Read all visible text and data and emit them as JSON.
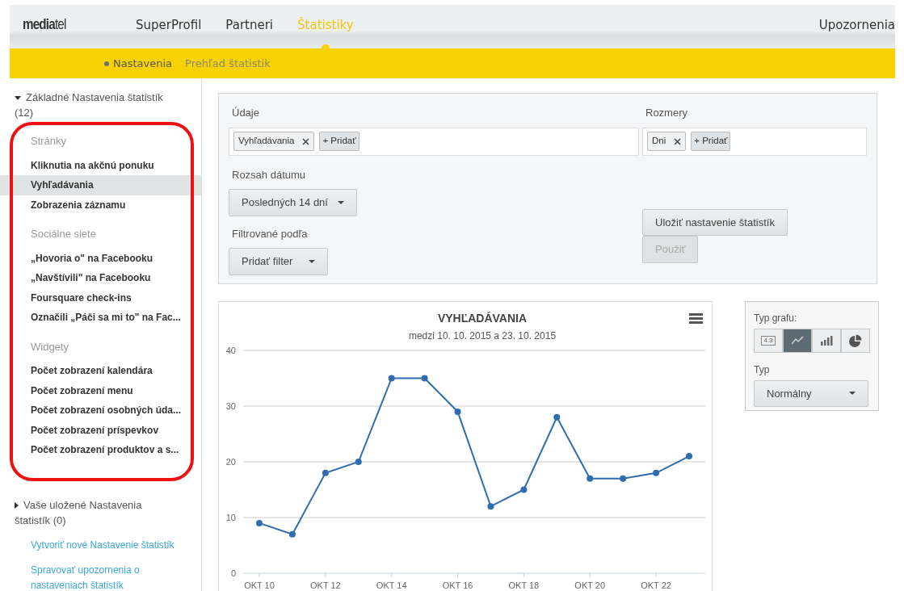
{
  "header": {
    "logo": {
      "main": "media",
      "accent": "tel"
    },
    "nav": [
      {
        "label": "SuperProfil",
        "selected": false
      },
      {
        "label": "Partneri",
        "selected": false
      },
      {
        "label": "Štatistiky",
        "selected": true
      }
    ],
    "right_link": "Upozornenia",
    "subnav": [
      {
        "label": "Nastavenia",
        "selected": true
      },
      {
        "label": "Prehľad štatistik",
        "selected": false
      }
    ]
  },
  "sidebar": {
    "sections": [
      {
        "label": "Základné Nastavenia štatistík (12)",
        "expanded": true,
        "groups": [
          {
            "heading": "Stránky",
            "items": [
              {
                "label": "Kliknutia na akčnú ponuku",
                "selected": false
              },
              {
                "label": "Vyhľadávania",
                "selected": true
              },
              {
                "label": "Zobrazenia záznamu",
                "selected": false
              }
            ]
          },
          {
            "heading": "Sociálne siete",
            "items": [
              {
                "label": "„Hovoria o\" na Facebooku",
                "selected": false
              },
              {
                "label": "„Navštívili\" na Facebooku",
                "selected": false
              },
              {
                "label": "Foursquare check-ins",
                "selected": false
              },
              {
                "label": "Označili „Páči sa mi to\" na Fac...",
                "selected": false
              }
            ]
          },
          {
            "heading": "Widgety",
            "items": [
              {
                "label": "Počet zobrazení kalendára",
                "selected": false
              },
              {
                "label": "Počet zobrazení menu",
                "selected": false
              },
              {
                "label": "Počet zobrazení osobných úda...",
                "selected": false
              },
              {
                "label": "Počet zobrazení príspevkov",
                "selected": false
              },
              {
                "label": "Počet zobrazení produktov a s...",
                "selected": false
              }
            ]
          }
        ]
      },
      {
        "label": "Vaše uložené Nastavenia štatistík (0)",
        "expanded": false
      }
    ],
    "links": [
      "Vytvoriť nové Nastavenie štatistík",
      "Spravovať upozornenia o nastaveniach štatistík"
    ]
  },
  "settings": {
    "data_label": "Údaje",
    "data_tags": [
      "Vyhľadávania"
    ],
    "data_add": "+ Pridať",
    "dims_label": "Rozmery",
    "dims_tags": [
      "Dni"
    ],
    "dims_add": "+ Pridať",
    "range_label": "Rozsah dátumu",
    "range_value": "Posledných 14 dní",
    "filter_label": "Filtrované podľa",
    "filter_button": "Pridať filter",
    "save_button": "Uložiť nastavenie štatistík",
    "apply_button": {
      "label": "Použiť",
      "disabled": true
    }
  },
  "chart": {
    "chart_data": {
      "type": "line",
      "title": "VYHĽADÁVANIA",
      "subtitle": "medzi 10. 10. 2015 a 23. 10. 2015",
      "categories": [
        "OKT 10",
        null,
        "OKT 12",
        null,
        "OKT 14",
        null,
        "OKT 16",
        null,
        "OKT 18",
        null,
        "OKT 20",
        null,
        "OKT 22",
        null
      ],
      "ylim": [
        0,
        40
      ],
      "yticks": [
        0,
        10,
        20,
        30,
        40
      ],
      "grid": true,
      "series": [
        {
          "marker": true,
          "color": "#2f6db0",
          "values": [
            9,
            7,
            18,
            20,
            35,
            35,
            29,
            12,
            15,
            28,
            17,
            17,
            18,
            21
          ]
        }
      ]
    }
  },
  "chart_options": {
    "type_label": "Typ grafu:",
    "types": [
      {
        "kind": "table",
        "label": "4.3",
        "selected": false
      },
      {
        "kind": "line",
        "selected": true
      },
      {
        "kind": "bar",
        "selected": false
      },
      {
        "kind": "pie",
        "selected": false
      }
    ],
    "mode_label": "Typ",
    "mode_value": "Normálny"
  }
}
